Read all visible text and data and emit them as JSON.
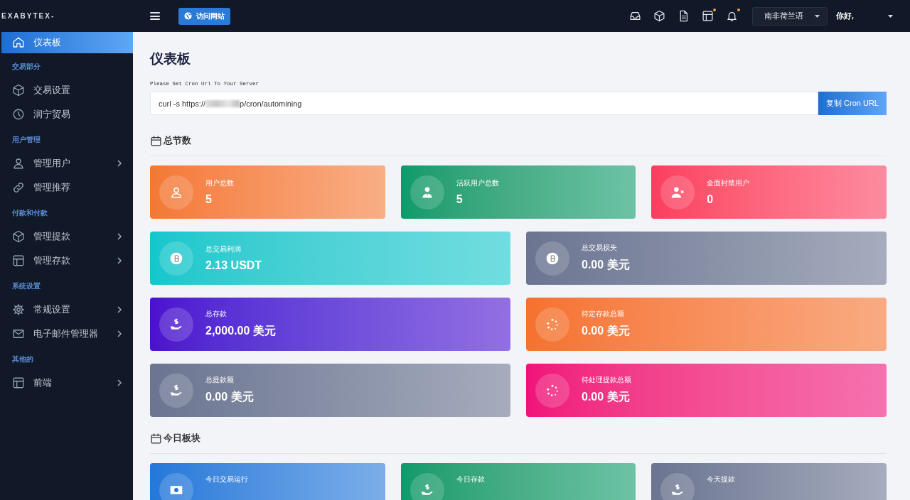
{
  "brand": "EXABYTEX-",
  "sidebar": {
    "items": [
      {
        "kind": "link",
        "label": "仪表板",
        "selected": true,
        "expandable": false
      },
      {
        "kind": "heading",
        "label": "交易部分"
      },
      {
        "kind": "link",
        "label": "交易设置",
        "selected": false,
        "expandable": false
      },
      {
        "kind": "link",
        "label": "润宁贸易",
        "selected": false,
        "expandable": false
      },
      {
        "kind": "heading",
        "label": "用户管理"
      },
      {
        "kind": "link",
        "label": "管理用户",
        "selected": false,
        "expandable": true
      },
      {
        "kind": "link",
        "label": "管理推荐",
        "selected": false,
        "expandable": false
      },
      {
        "kind": "heading",
        "label": "付款和付款"
      },
      {
        "kind": "link",
        "label": "管理提款",
        "selected": false,
        "expandable": true
      },
      {
        "kind": "link",
        "label": "管理存款",
        "selected": false,
        "expandable": true
      },
      {
        "kind": "heading",
        "label": "系统设置"
      },
      {
        "kind": "link",
        "label": "常规设置",
        "selected": false,
        "expandable": true
      },
      {
        "kind": "link",
        "label": "电子邮件管理器",
        "selected": false,
        "expandable": true
      },
      {
        "kind": "heading",
        "label": "其他的"
      },
      {
        "kind": "link",
        "label": "前端",
        "selected": false,
        "expandable": true
      }
    ]
  },
  "topbar": {
    "visit_button": "访问网站",
    "icons": [
      {
        "kind": "inbox",
        "dot": false
      },
      {
        "kind": "cube",
        "dot": false
      },
      {
        "kind": "document",
        "dot": false
      },
      {
        "kind": "layout",
        "dot": true
      },
      {
        "kind": "bell",
        "dot": true
      }
    ],
    "language": "南非荷兰语",
    "greeting": "你好,"
  },
  "page": {
    "title": "仪表板",
    "cron_label": "Please Set Cron Url To Your Server",
    "cron_value_start": "curl -s https://",
    "cron_value_end": "p/cron/automining",
    "copy_button": "复制 Cron URL"
  },
  "sections": [
    {
      "title": "总节数",
      "rows": [
        [
          {
            "kind": "user",
            "color": "#f47834",
            "label": "用户总数",
            "value": "5"
          },
          {
            "kind": "user-tie",
            "color": "#0c9a6a",
            "label": "活跃用户总数",
            "value": "5"
          },
          {
            "kind": "user-x",
            "color": "#fb3d5f",
            "label": "全面封禁用户",
            "value": "0"
          }
        ],
        [
          {
            "kind": "coin",
            "color": "#12c7cc",
            "label": "总交易利润",
            "value": "2.13 USDT"
          },
          {
            "kind": "coin",
            "color": "#6b7591",
            "label": "总交易损失",
            "value": "0.00 美元"
          }
        ],
        [
          {
            "kind": "deposit",
            "color": "#4c0fd0",
            "label": "总存款",
            "value": "2,000.00 美元"
          },
          {
            "kind": "pending",
            "color": "#f5722e",
            "label": "待定存款总额",
            "value": "0.00 美元"
          }
        ],
        [
          {
            "kind": "deposit",
            "color": "#6b7591",
            "label": "总提款额",
            "value": "0.00 美元"
          },
          {
            "kind": "pending",
            "color": "#f0127a",
            "label": "待处理提款总额",
            "value": "0.00 美元"
          }
        ]
      ]
    },
    {
      "title": "今日板块",
      "rows": [
        [
          {
            "kind": "cash",
            "color": "#2378d9",
            "label": "今日交易运行"
          },
          {
            "kind": "deposit",
            "color": "#0c9a6a",
            "label": "今日存款"
          },
          {
            "kind": "deposit",
            "color": "#6b7591",
            "label": "今天提款"
          }
        ]
      ]
    }
  ]
}
